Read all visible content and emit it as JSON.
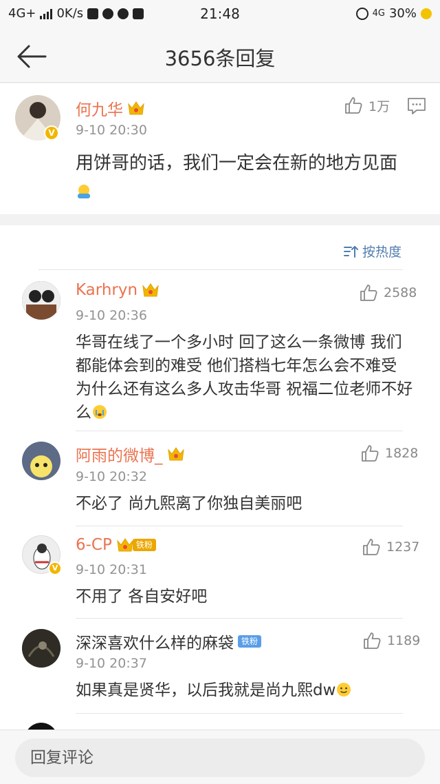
{
  "status_bar": {
    "network": "4G+",
    "speed": "0K/s",
    "time": "21:48",
    "net_right": "4G",
    "battery": "30%"
  },
  "nav": {
    "title": "3656条回复"
  },
  "root_comment": {
    "username": "何九华",
    "time": "9-10 20:30",
    "likes": "1万",
    "text": "用饼哥的话，我们一定会在新的地方见面"
  },
  "sort": {
    "label": "按热度"
  },
  "replies": [
    {
      "username": "Karhryn",
      "time": "9-10 20:36",
      "likes": "2588",
      "text": "华哥在线了一个多小时 回了这么一条微博 我们都能体会到的难受 他们搭档七年怎么会不难受 为什么还有这么多人攻击华哥 祝福二位老师不好么"
    },
    {
      "username": "阿雨的微博_",
      "time": "9-10 20:32",
      "likes": "1828",
      "text": "不必了 尚九熙离了你独自美丽吧"
    },
    {
      "username": "6-CP",
      "badge": "铁粉",
      "time": "9-10 20:31",
      "likes": "1237",
      "text": "不用了 各自安好吧"
    },
    {
      "username": "深深喜欢什么样的麻袋",
      "badge": "铁粉",
      "time": "9-10 20:37",
      "likes": "1189",
      "text": "如果真是贤华，以后我就是尚九熙dw"
    }
  ],
  "bottom": {
    "placeholder": "回复评论"
  },
  "colors": {
    "username": "#eb7350",
    "link": "#507daf",
    "crown": "#f3b600"
  }
}
